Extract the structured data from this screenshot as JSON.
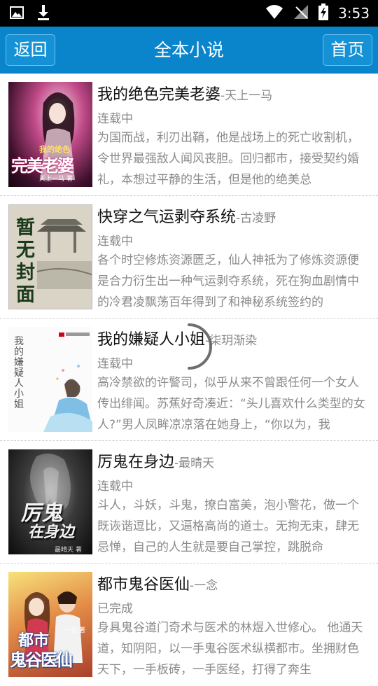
{
  "status_bar": {
    "time": "3:53"
  },
  "header": {
    "back_label": "返回",
    "title": "全本小说",
    "home_label": "首页"
  },
  "books": [
    {
      "title": "我的绝色完美老婆",
      "author": "-天上一马",
      "status": "连载中",
      "description": "为国而战，利刃出鞘，他是战场上的死亡收割机，令世界最强敌人闻风丧胆。回归都市，接受契约婚礼，本想过平静的生活，但是他的绝美总",
      "cover_text": [
        "我的绝色",
        "完美老婆",
        "天上一马 著"
      ]
    },
    {
      "title": "快穿之气运剥夺系统",
      "author": "-古凌野",
      "status": "连载中",
      "description": "各个时空修炼资源匮乏，仙人神祗为了修炼资源便是合力衍生出一种气运剥夺系统，死在狗血剧情中的冷君凌飘荡百年得到了和神秘系统签约的",
      "cover_text": [
        "暂",
        "无",
        "封",
        "面"
      ]
    },
    {
      "title": "我的嫌疑人小姐",
      "author": "-柒玥渐染",
      "status": "连载中",
      "description": "高冷禁欲的许警司，似乎从来不曾跟任何一个女人传出绯闻。苏蕉好奇凑近：“头儿喜欢什么类型的女人?”男人凤眸凉凉落在她身上，“你以为，我",
      "cover_text": [
        "我的嫌疑人小姐"
      ]
    },
    {
      "title": "厉鬼在身边",
      "author": "-最晴天",
      "status": "连载中",
      "description": "斗人，斗妖，斗鬼，撩白富美，泡小警花，做一个既诙谐逗比，又逼格高尚的道士。无拘无束，肆无忌惮，自己的人生就是要自己掌控，跳脱命",
      "cover_text": [
        "厉鬼",
        "在身边",
        "最晴天 著"
      ]
    },
    {
      "title": "都市鬼谷医仙",
      "author": "-一念",
      "status": "已完成",
      "description": "身具鬼谷道门奇术与医术的林煜入世修心。 他通天道，知阴阳，以一手鬼谷医术纵横都市。坐拥财色天下，一手板砖，一手医经，打得了奔生",
      "cover_text": [
        "都市",
        "鬼谷医仙",
        "一念 著"
      ]
    }
  ]
}
